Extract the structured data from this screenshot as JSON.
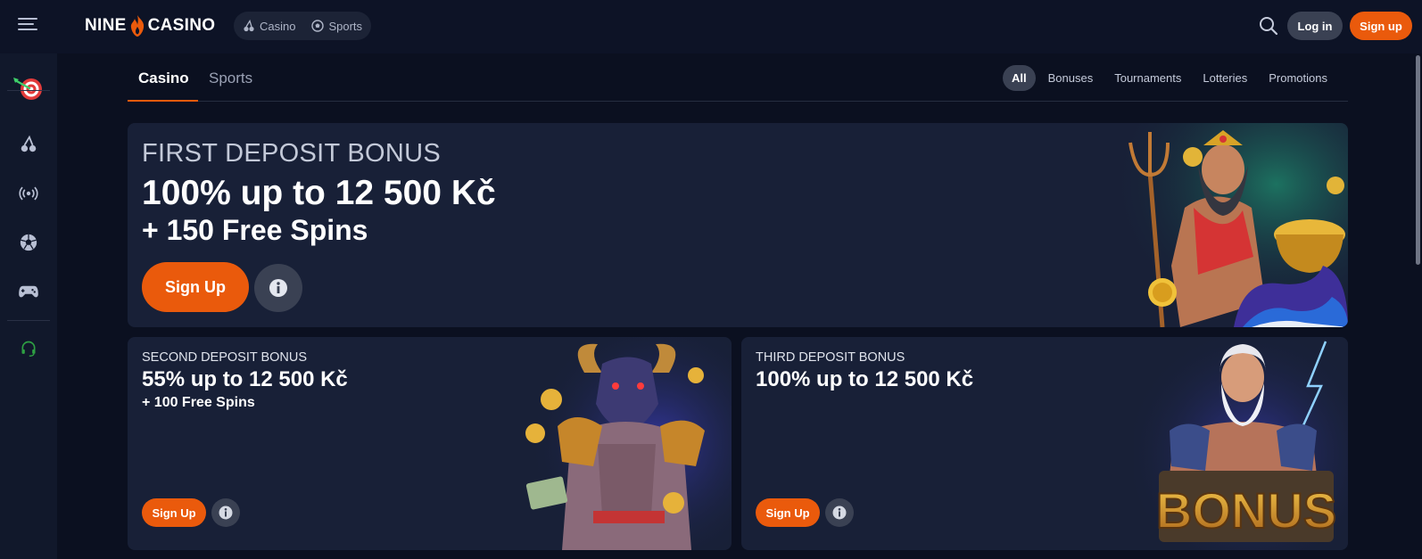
{
  "brand": {
    "name_left": "NINE",
    "name_right": "CASINO",
    "accent": "#ea5a0c",
    "background": "#0b1020",
    "card_background": "#182037"
  },
  "header": {
    "nav": [
      {
        "label": "Casino",
        "icon": "cherries-icon"
      },
      {
        "label": "Sports",
        "icon": "soccer-ball-icon"
      }
    ],
    "login_label": "Log in",
    "signup_label": "Sign up"
  },
  "sidebar": {
    "items": [
      {
        "icon": "dart-target-icon"
      },
      {
        "icon": "cherries-icon"
      },
      {
        "icon": "live-broadcast-icon"
      },
      {
        "icon": "soccer-ball-icon"
      },
      {
        "icon": "gamepad-icon"
      },
      {
        "icon": "headset-support-icon"
      }
    ]
  },
  "main": {
    "tabs": [
      {
        "label": "Casino",
        "active": true
      },
      {
        "label": "Sports",
        "active": false
      }
    ],
    "filters": [
      {
        "label": "All",
        "active": true
      },
      {
        "label": "Bonuses",
        "active": false
      },
      {
        "label": "Tournaments",
        "active": false
      },
      {
        "label": "Lotteries",
        "active": false
      },
      {
        "label": "Promotions",
        "active": false
      }
    ]
  },
  "promos": {
    "first": {
      "title": "FIRST DEPOSIT BONUS",
      "amount": "100% up to 12 500 Kč",
      "spins": "+ 150 Free Spins",
      "cta": "Sign Up",
      "info_icon": "info-icon",
      "art": "poseidon-with-trident-and-gold-pot"
    },
    "second": {
      "title": "SECOND DEPOSIT BONUS",
      "amount": "55% up to 12 500 Kč",
      "spins": "+ 100 Free Spins",
      "cta": "Sign Up",
      "info_icon": "info-icon",
      "art": "minotaur-warrior-with-cash"
    },
    "third": {
      "title": "THIRD DEPOSIT BONUS",
      "amount": "100% up to 12 500 Kč",
      "cta": "Sign Up",
      "info_icon": "info-icon",
      "art": "zeus-with-bonus-sign",
      "art_text": "BONUS"
    }
  }
}
